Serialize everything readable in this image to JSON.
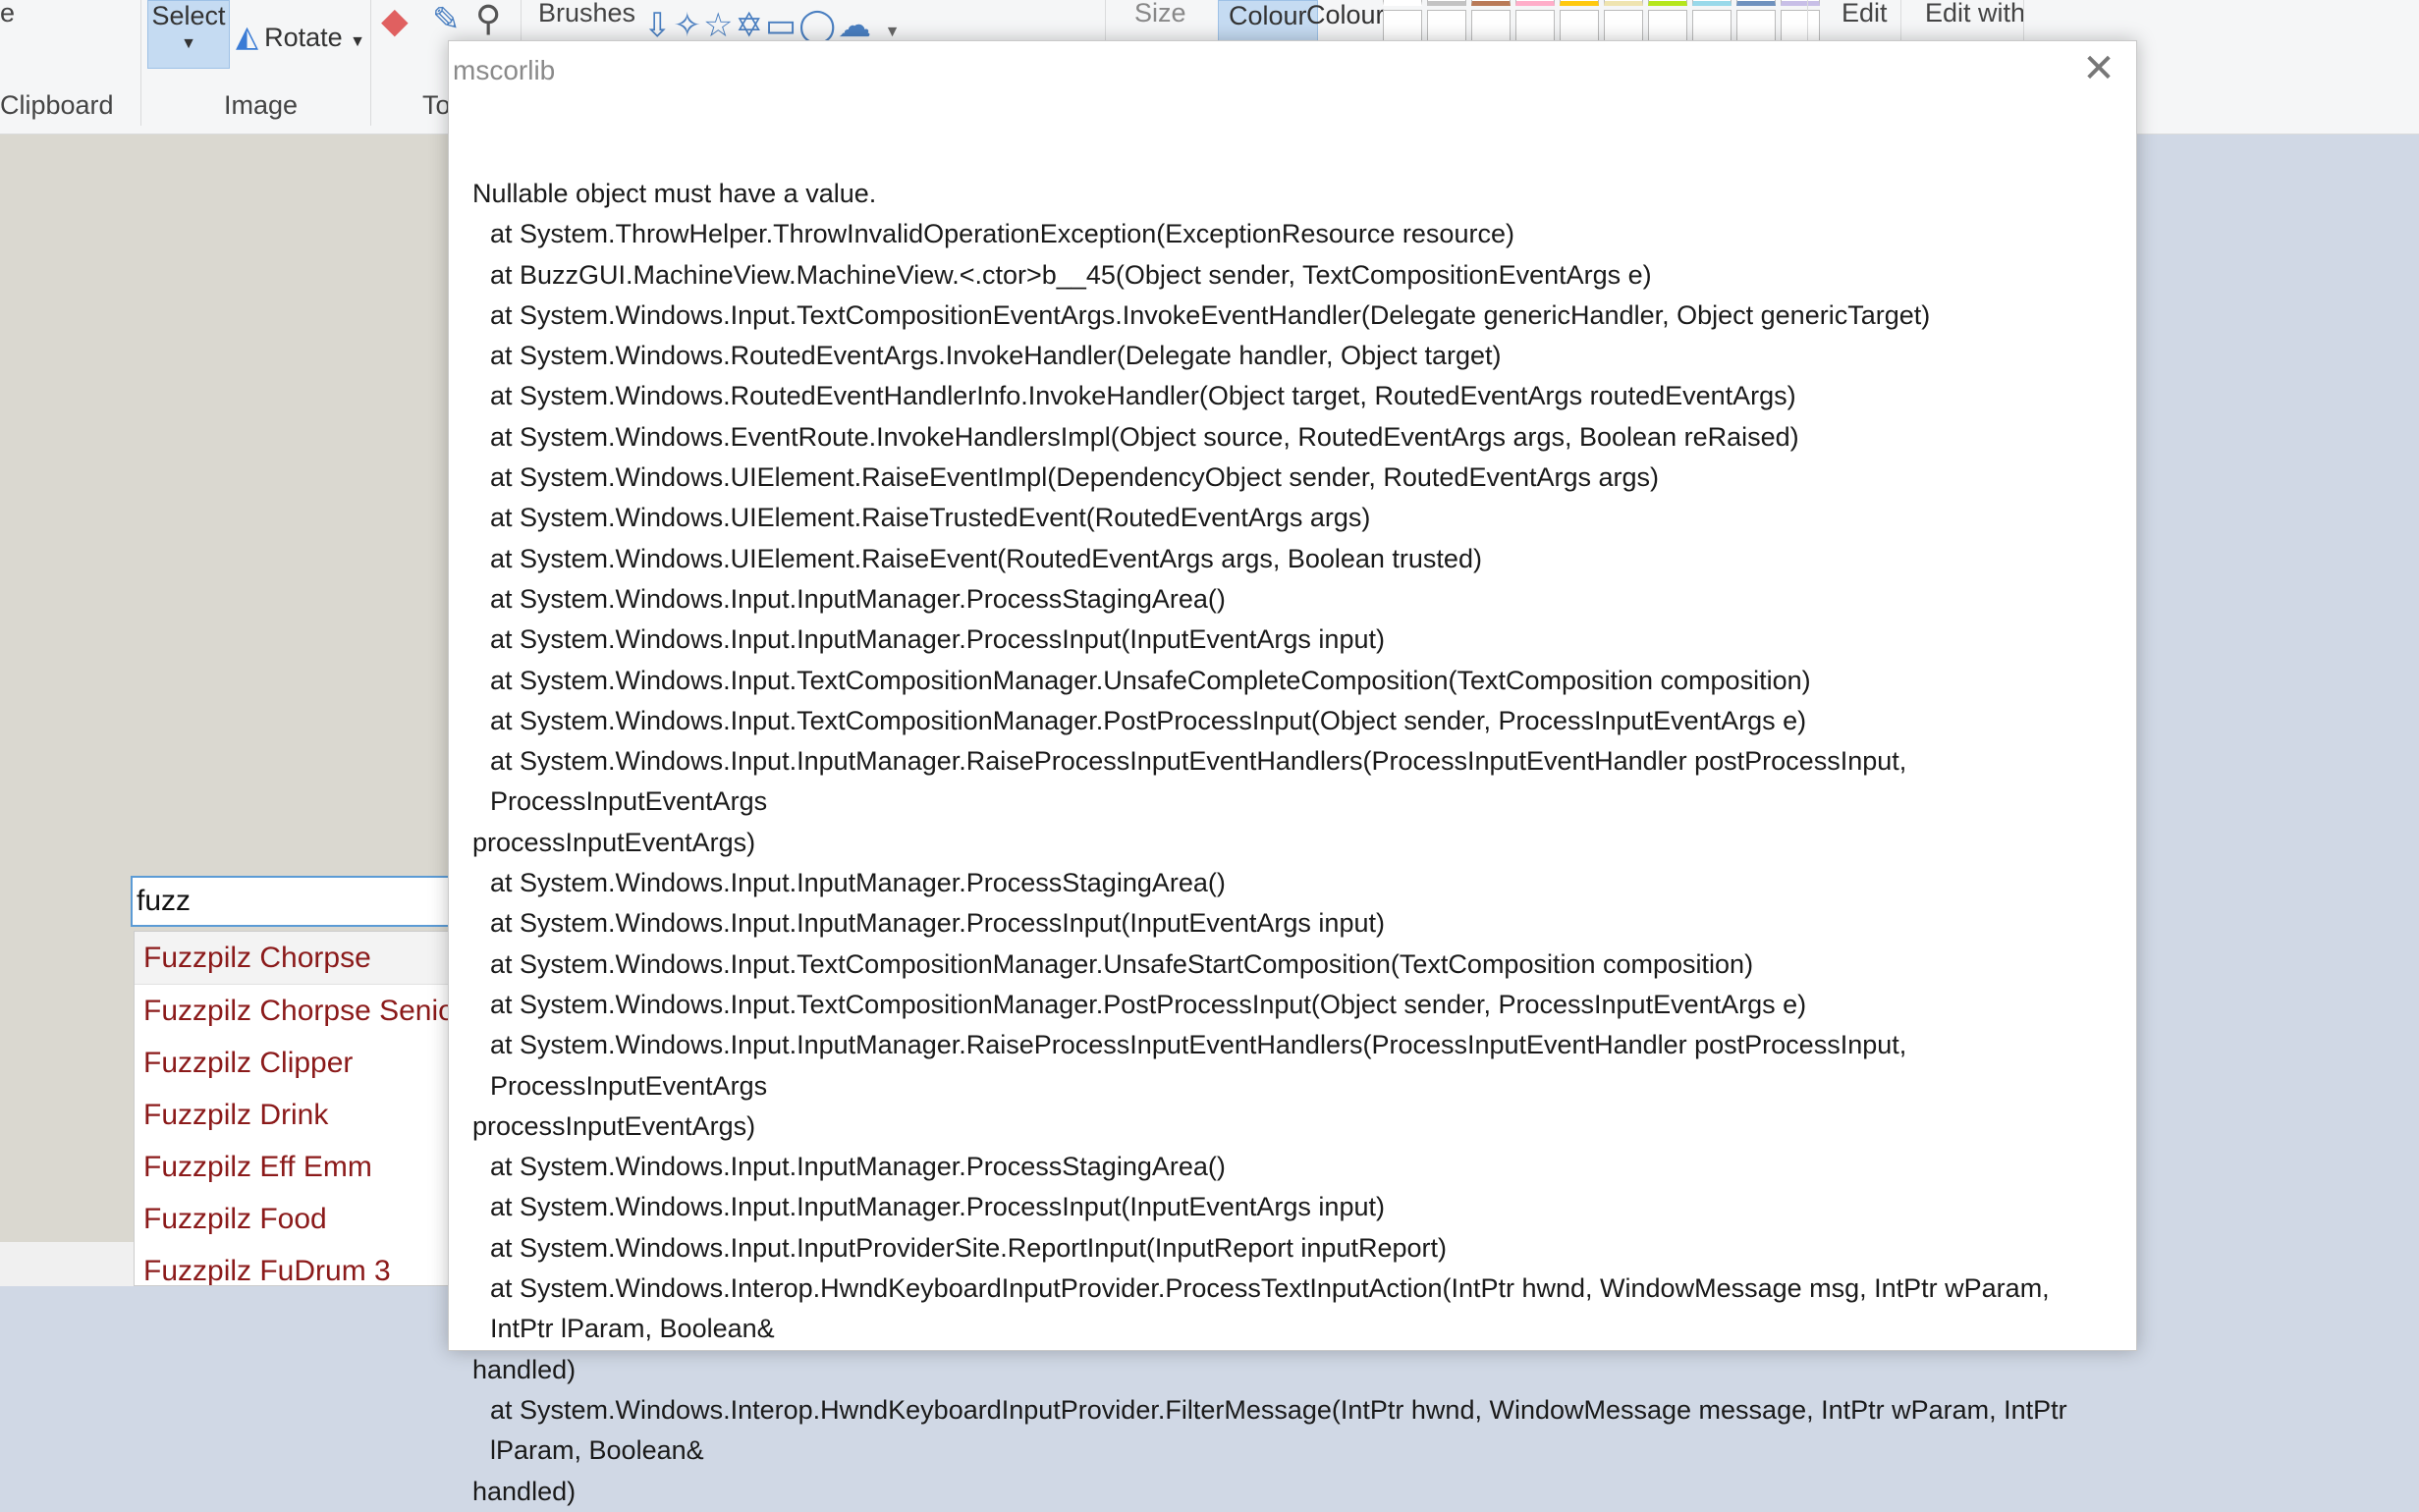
{
  "ribbon": {
    "clipboard_partial": "e",
    "clipboard_label": "Clipboard",
    "select_label": "Select",
    "rotate_label": "Rotate",
    "image_label": "Image",
    "tools_partial": "To",
    "brushes_label": "Brushes",
    "size_label": "Size",
    "colour1_label": "Colour",
    "colour2_label": "Colour",
    "edit_label": "Edit",
    "edit_with_label": "Edit with",
    "palette_row1": [
      "#ffffff",
      "#c3c3c3",
      "#b97a57",
      "#ffaec9",
      "#ffc90e",
      "#efe4b0",
      "#b5e61d",
      "#99d9ea",
      "#7092be",
      "#c8bfe7"
    ]
  },
  "autocomplete": {
    "query": "fuzz",
    "suggestions": [
      "Fuzzpilz Chorpse",
      "Fuzzpilz Chorpse Senior",
      "Fuzzpilz Clipper",
      "Fuzzpilz Drink",
      "Fuzzpilz Eff Emm",
      "Fuzzpilz Food",
      "Fuzzpilz FuDrum 3"
    ]
  },
  "dialog": {
    "title": "mscorlib",
    "close_glyph": "✕",
    "lines": [
      {
        "text": "Nullable object must have a value.",
        "indent": false
      },
      {
        "text": "at System.ThrowHelper.ThrowInvalidOperationException(ExceptionResource resource)",
        "indent": true
      },
      {
        "text": "at BuzzGUI.MachineView.MachineView.<.ctor>b__45(Object sender, TextCompositionEventArgs e)",
        "indent": true
      },
      {
        "text": "at System.Windows.Input.TextCompositionEventArgs.InvokeEventHandler(Delegate genericHandler, Object genericTarget)",
        "indent": true
      },
      {
        "text": "at System.Windows.RoutedEventArgs.InvokeHandler(Delegate handler, Object target)",
        "indent": true
      },
      {
        "text": "at System.Windows.RoutedEventHandlerInfo.InvokeHandler(Object target, RoutedEventArgs routedEventArgs)",
        "indent": true
      },
      {
        "text": "at System.Windows.EventRoute.InvokeHandlersImpl(Object source, RoutedEventArgs args, Boolean reRaised)",
        "indent": true
      },
      {
        "text": "at System.Windows.UIElement.RaiseEventImpl(DependencyObject sender, RoutedEventArgs args)",
        "indent": true
      },
      {
        "text": "at System.Windows.UIElement.RaiseTrustedEvent(RoutedEventArgs args)",
        "indent": true
      },
      {
        "text": "at System.Windows.UIElement.RaiseEvent(RoutedEventArgs args, Boolean trusted)",
        "indent": true
      },
      {
        "text": "at System.Windows.Input.InputManager.ProcessStagingArea()",
        "indent": true
      },
      {
        "text": "at System.Windows.Input.InputManager.ProcessInput(InputEventArgs input)",
        "indent": true
      },
      {
        "text": "at System.Windows.Input.TextCompositionManager.UnsafeCompleteComposition(TextComposition composition)",
        "indent": true
      },
      {
        "text": "at System.Windows.Input.TextCompositionManager.PostProcessInput(Object sender, ProcessInputEventArgs e)",
        "indent": true
      },
      {
        "text": "at System.Windows.Input.InputManager.RaiseProcessInputEventHandlers(ProcessInputEventHandler postProcessInput, ProcessInputEventArgs",
        "indent": true
      },
      {
        "text": "processInputEventArgs)",
        "indent": false
      },
      {
        "text": "at System.Windows.Input.InputManager.ProcessStagingArea()",
        "indent": true
      },
      {
        "text": "at System.Windows.Input.InputManager.ProcessInput(InputEventArgs input)",
        "indent": true
      },
      {
        "text": "at System.Windows.Input.TextCompositionManager.UnsafeStartComposition(TextComposition composition)",
        "indent": true
      },
      {
        "text": "at System.Windows.Input.TextCompositionManager.PostProcessInput(Object sender, ProcessInputEventArgs e)",
        "indent": true
      },
      {
        "text": "at System.Windows.Input.InputManager.RaiseProcessInputEventHandlers(ProcessInputEventHandler postProcessInput, ProcessInputEventArgs",
        "indent": true
      },
      {
        "text": "processInputEventArgs)",
        "indent": false
      },
      {
        "text": "at System.Windows.Input.InputManager.ProcessStagingArea()",
        "indent": true
      },
      {
        "text": "at System.Windows.Input.InputManager.ProcessInput(InputEventArgs input)",
        "indent": true
      },
      {
        "text": "at System.Windows.Input.InputProviderSite.ReportInput(InputReport inputReport)",
        "indent": true
      },
      {
        "text": "at System.Windows.Interop.HwndKeyboardInputProvider.ProcessTextInputAction(IntPtr hwnd, WindowMessage msg, IntPtr wParam, IntPtr lParam, Boolean&",
        "indent": true
      },
      {
        "text": "handled)",
        "indent": false
      },
      {
        "text": "at System.Windows.Interop.HwndKeyboardInputProvider.FilterMessage(IntPtr hwnd, WindowMessage message, IntPtr wParam, IntPtr lParam, Boolean&",
        "indent": true
      },
      {
        "text": "handled)",
        "indent": false
      }
    ]
  }
}
